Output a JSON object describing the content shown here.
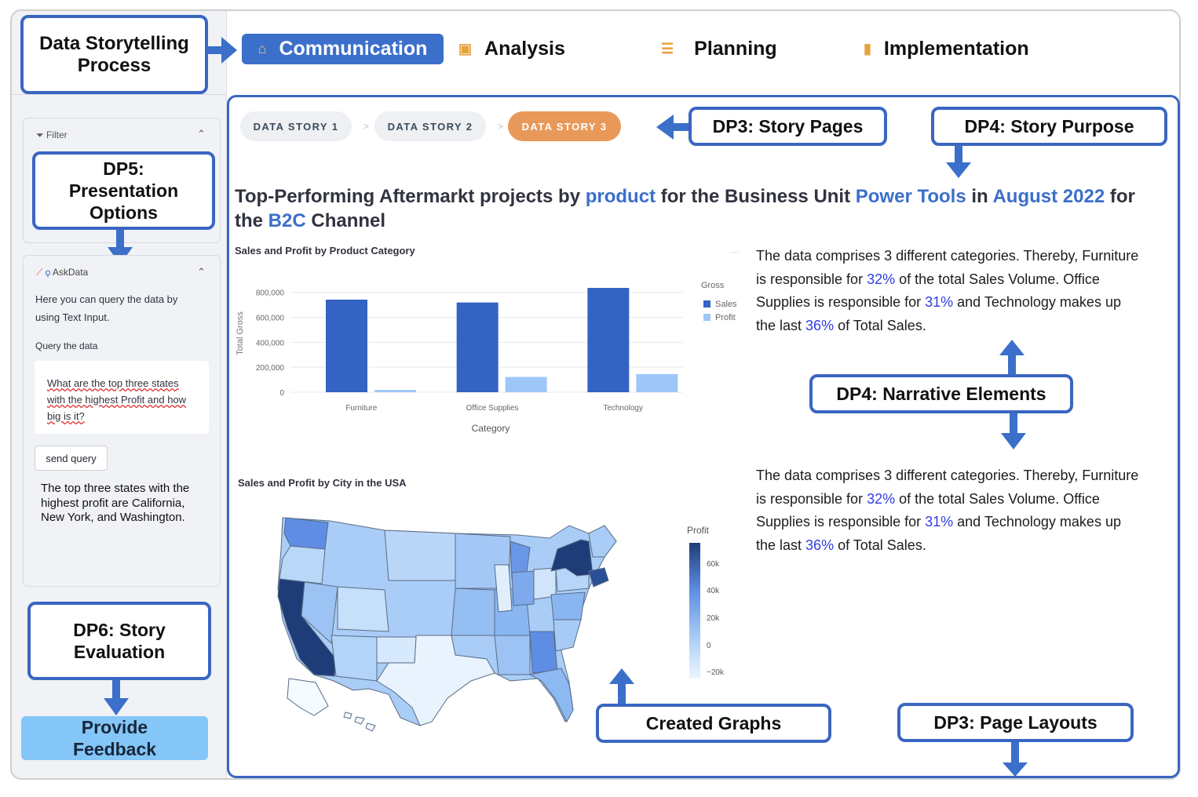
{
  "callouts": {
    "process": "Data Storytelling\nProcess",
    "presentation": "DP5:\nPresentation\nOptions",
    "evaluation": "DP6: Story\nEvaluation",
    "story_pages": "DP3: Story Pages",
    "story_purpose": "DP4: Story Purpose",
    "narrative": "DP4: Narrative Elements",
    "graphs": "Created Graphs",
    "layouts": "DP3: Page Layouts"
  },
  "nav": {
    "tabs": [
      {
        "label": "Communication",
        "icon": "home-icon",
        "active": true
      },
      {
        "label": "Analysis",
        "icon": "clipboard-icon",
        "active": false
      },
      {
        "label": "Planning",
        "icon": "list-icon",
        "active": false
      },
      {
        "label": "Implementation",
        "icon": "bar-chart-icon",
        "active": false
      }
    ]
  },
  "sidebar": {
    "filter": {
      "label": "Filter",
      "icon": "filter-icon"
    },
    "askdata": {
      "label": "AskData",
      "icons": [
        "chart-icon",
        "search-icon"
      ],
      "description": "Here you can query the data by using Text Input.",
      "query_label": "Query the data",
      "query_value": "What are the top three states with the highest Profit and how big is it?",
      "send_label": "send query",
      "answer": "The top three states with the highest profit are California, New York, and Washington."
    },
    "feedback_label": "Provide\nFeedback"
  },
  "stories": {
    "items": [
      "DATA STORY 1",
      "DATA STORY 2",
      "DATA STORY 3"
    ],
    "active_index": 2,
    "separator": ">"
  },
  "headline": {
    "p1": "Top-Performing Aftermarkt projects by ",
    "h1": "product",
    "p2": " for the Business Unit ",
    "h2": "Power Tools",
    "p3": " in ",
    "h3": "August 2022",
    "p4": " for the ",
    "h4": "B2C",
    "p5": " Channel"
  },
  "narrative": {
    "p1": "The data comprises 3 different categories. Thereby, Furniture is responsible for ",
    "v1": "32%",
    "p2": " of the total Sales Volume. Office Supplies is responsible for ",
    "v2": "31%",
    "p3": " and Technology makes up the last ",
    "v3": "36%",
    "p4": " of Total Sales."
  },
  "bar_menu": "···",
  "chart_data": [
    {
      "type": "bar",
      "title": "Sales and Profit by Product Category",
      "xlabel": "Category",
      "ylabel": "Total Gross",
      "categories": [
        "Furniture",
        "Office Supplies",
        "Technology"
      ],
      "series": [
        {
          "name": "Sales",
          "values": [
            742000,
            719000,
            836000
          ],
          "color": "#3563c4"
        },
        {
          "name": "Profit",
          "values": [
            18500,
            122500,
            145500
          ],
          "color": "#9ec7f7"
        }
      ],
      "ylim": [
        0,
        880000
      ],
      "yticks": [
        0,
        200000,
        400000,
        600000,
        800000
      ],
      "ytick_labels": [
        "0",
        "200,000",
        "400,000",
        "600,000",
        "800,000"
      ],
      "legend_title": "Gross",
      "legend_position": "right",
      "grid": true
    },
    {
      "type": "choropleth",
      "title": "Sales and Profit by City in the USA",
      "colorbar_title": "Profit",
      "colorbar_ticks": [
        "60k",
        "40k",
        "20k",
        "0",
        "−20k"
      ],
      "colorscale": [
        "#e8f3fd",
        "#1e3d78"
      ],
      "highlighted": [
        {
          "state": "California",
          "level": 1.0
        },
        {
          "state": "New York",
          "level": 1.0
        },
        {
          "state": "Washington",
          "level": 0.6
        },
        {
          "state": "Texas",
          "level": 0.0
        }
      ]
    }
  ],
  "colors": {
    "accent": "#3b6fc9",
    "story_active": "#e8995a",
    "callout_border": "#3a66c2",
    "feedback": "#83c6f7"
  }
}
